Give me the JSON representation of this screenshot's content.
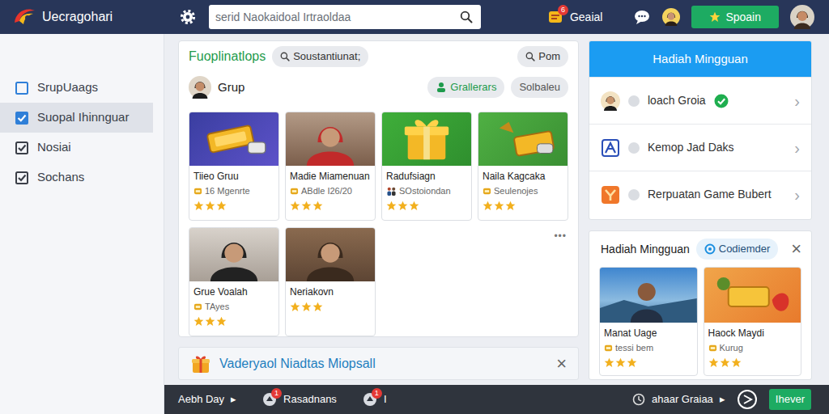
{
  "app": {
    "title": "Uecragohari"
  },
  "search": {
    "placeholder": "serid Naokaidoal Irtraoldaa"
  },
  "topbar": {
    "notice": {
      "label": "Geaial",
      "badge": "6"
    },
    "button": "Spoain"
  },
  "sidebar": {
    "items": [
      {
        "label": "SrupUaags",
        "selected": false
      },
      {
        "label": "Suopal Ihinnguar",
        "selected": true
      },
      {
        "label": "Nosiai",
        "selected": false
      },
      {
        "label": "Sochans",
        "selected": false
      }
    ]
  },
  "panel": {
    "title": "Fuoplinatlops",
    "filter": "Soustantiunat;",
    "search": "Pom",
    "group": "Grup",
    "actions": [
      {
        "label": "Grallerars",
        "selected": true
      },
      {
        "label": "Solbaleu",
        "selected": false
      }
    ],
    "more": "•••",
    "cards": [
      {
        "title": "Tiieo Gruu",
        "subtitle": "16 Mgenrte",
        "stars": 3
      },
      {
        "title": "Madie Miamenuan",
        "subtitle": "ABdle I26/20",
        "stars": 3
      },
      {
        "title": "Radufsiagn",
        "subtitle": "SOstoiondan",
        "stars": 3
      },
      {
        "title": "Naila Kagcaka",
        "subtitle": "Seulenojes",
        "stars": 3
      },
      {
        "title": "Grue Voalah",
        "subtitle": "TAyes",
        "stars": 3
      },
      {
        "title": "Neriakovn",
        "stars": 3
      }
    ]
  },
  "banner": {
    "text": "Vaderyaol Niadtas Miopsall",
    "close": "×"
  },
  "rewards": {
    "title": "Hadiah Mingguan",
    "chevron": "›",
    "items": [
      {
        "label": "loach Groia",
        "verified": true
      },
      {
        "label": "Kemop Jad Daks",
        "verified": false
      },
      {
        "label": "Rerpuatan Game Bubert",
        "verified": false
      }
    ]
  },
  "weekly": {
    "title": "Hadiah Mingguan",
    "filter": "Codiemder",
    "close": "×",
    "cards": [
      {
        "title": "Manat Uage",
        "subtitle": "tessi bem",
        "stars": 3
      },
      {
        "title": "Haock Maydi",
        "subtitle": "Kurug",
        "stars": 3
      }
    ]
  },
  "status_bar": {
    "menu": "Aebh Day",
    "arrow": "▸",
    "alerts": [
      {
        "label": "Rasadnans",
        "badge": "1"
      },
      {
        "label": "I",
        "badge": "1"
      }
    ],
    "status": "ahaar Graiaa",
    "status_arrow": "▸",
    "button": "Ihever"
  }
}
